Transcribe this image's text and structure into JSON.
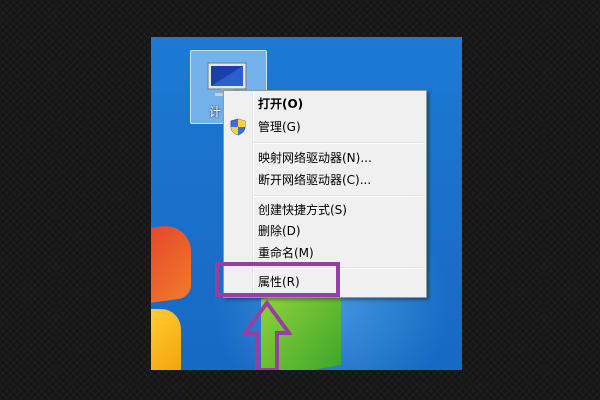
{
  "desktop": {
    "computer_icon": {
      "label": "计",
      "icon": "computer-monitor-icon"
    }
  },
  "context_menu": {
    "items": [
      {
        "label": "打开(O)",
        "bold": true
      },
      {
        "label": "管理(G)",
        "icon": "uac-shield-icon"
      },
      {
        "label": "映射网络驱动器(N)..."
      },
      {
        "label": "断开网络驱动器(C)..."
      },
      {
        "label": "创建快捷方式(S)"
      },
      {
        "label": "删除(D)"
      },
      {
        "label": "重命名(M)"
      },
      {
        "label": "属性(R)"
      }
    ]
  },
  "annotation": {
    "highlight_color": "#9b3ea2",
    "highlighted_item": "属性(R)",
    "arrow_icon": "up-arrow-icon"
  }
}
